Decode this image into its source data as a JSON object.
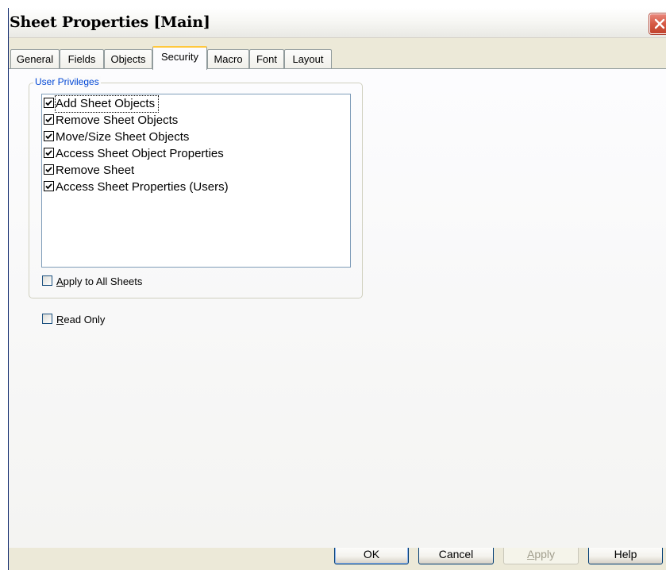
{
  "window": {
    "title": "Sheet Properties [Main]"
  },
  "tabs": [
    {
      "label": "General"
    },
    {
      "label": "Fields"
    },
    {
      "label": "Objects"
    },
    {
      "label": "Security",
      "active": true
    },
    {
      "label": "Macro"
    },
    {
      "label": "Font"
    },
    {
      "label": "Layout"
    }
  ],
  "user_privileges": {
    "legend": "User Privileges",
    "items": [
      {
        "label": "Add Sheet Objects",
        "checked": true
      },
      {
        "label": "Remove Sheet Objects",
        "checked": true
      },
      {
        "label": "Move/Size Sheet Objects",
        "checked": true
      },
      {
        "label": "Access Sheet Object Properties",
        "checked": true
      },
      {
        "label": "Remove Sheet",
        "checked": true
      },
      {
        "label": "Access Sheet Properties (Users)",
        "checked": true
      }
    ],
    "apply_all": {
      "label_mnemonic": "A",
      "label_rest": "pply to All Sheets",
      "checked": false
    }
  },
  "read_only": {
    "label_mnemonic": "R",
    "label_rest": "ead Only",
    "checked": false
  },
  "buttons": {
    "ok": "OK",
    "cancel": "Cancel",
    "apply_mnemonic": "A",
    "apply_rest": "pply",
    "help": "Help"
  },
  "colors": {
    "dialog_bg": "#ece9d8",
    "legend_text": "#0046d5",
    "active_tab_accent": "#ffc83c",
    "close_button": "#d65a45"
  }
}
